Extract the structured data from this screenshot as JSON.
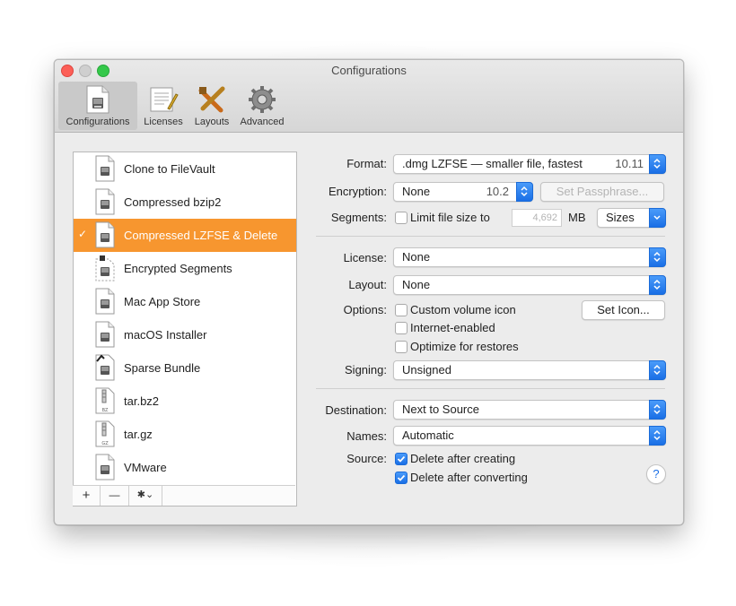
{
  "window": {
    "title": "Configurations"
  },
  "toolbar": {
    "items": [
      {
        "label": "Configurations",
        "icon": "document-icon",
        "selected": true
      },
      {
        "label": "Licenses",
        "icon": "license-icon"
      },
      {
        "label": "Layouts",
        "icon": "layouts-icon"
      },
      {
        "label": "Advanced",
        "icon": "gear-icon"
      }
    ]
  },
  "list": {
    "items": [
      {
        "label": "Clone to FileVault",
        "icon": "disk-image-icon"
      },
      {
        "label": "Compressed bzip2",
        "icon": "disk-image-icon"
      },
      {
        "label": "Compressed LZFSE & Delete",
        "icon": "disk-image-icon",
        "selected": true,
        "checkmark": "✓"
      },
      {
        "label": "Encrypted Segments",
        "icon": "encrypted-disk-image-icon"
      },
      {
        "label": "Mac App Store",
        "icon": "disk-image-icon"
      },
      {
        "label": "macOS Installer",
        "icon": "disk-image-icon"
      },
      {
        "label": "Sparse Bundle",
        "icon": "sparse-bundle-icon"
      },
      {
        "label": "tar.bz2",
        "icon": "archive-icon",
        "tag": "BZ"
      },
      {
        "label": "tar.gz",
        "icon": "archive-icon",
        "tag": "GZ"
      },
      {
        "label": "VMware",
        "icon": "disk-image-icon"
      }
    ],
    "footer": {
      "add": "+",
      "remove": "—",
      "action": "✱⌄"
    }
  },
  "form": {
    "format": {
      "label": "Format:",
      "value": ".dmg LZFSE — smaller file, fastest",
      "version": "10.11"
    },
    "encryption": {
      "label": "Encryption:",
      "value": "None",
      "version": "10.2",
      "passphrase_button": "Set Passphrase..."
    },
    "segments": {
      "label": "Segments:",
      "checkbox_label": "Limit file size to",
      "size_value": "4,692",
      "unit": "MB",
      "sizes_popup": "Sizes",
      "checked": false
    },
    "license": {
      "label": "License:",
      "value": "None"
    },
    "layout": {
      "label": "Layout:",
      "value": "None"
    },
    "options": {
      "label": "Options:",
      "custom_volume_icon": "Custom volume icon",
      "internet_enabled": "Internet-enabled",
      "optimize_for_restores": "Optimize for restores",
      "set_icon_button": "Set Icon..."
    },
    "signing": {
      "label": "Signing:",
      "value": "Unsigned"
    },
    "destination": {
      "label": "Destination:",
      "value": "Next to Source"
    },
    "names": {
      "label": "Names:",
      "value": "Automatic"
    },
    "source": {
      "label": "Source:",
      "delete_after_creating": "Delete after creating",
      "delete_after_converting": "Delete after converting",
      "delete_after_creating_checked": true,
      "delete_after_converting_checked": true
    },
    "help": "?"
  },
  "colors": {
    "selection": "#f7962f",
    "accent": "#1a6fe6",
    "close": "#fc5f57",
    "maximize": "#34c84a"
  }
}
